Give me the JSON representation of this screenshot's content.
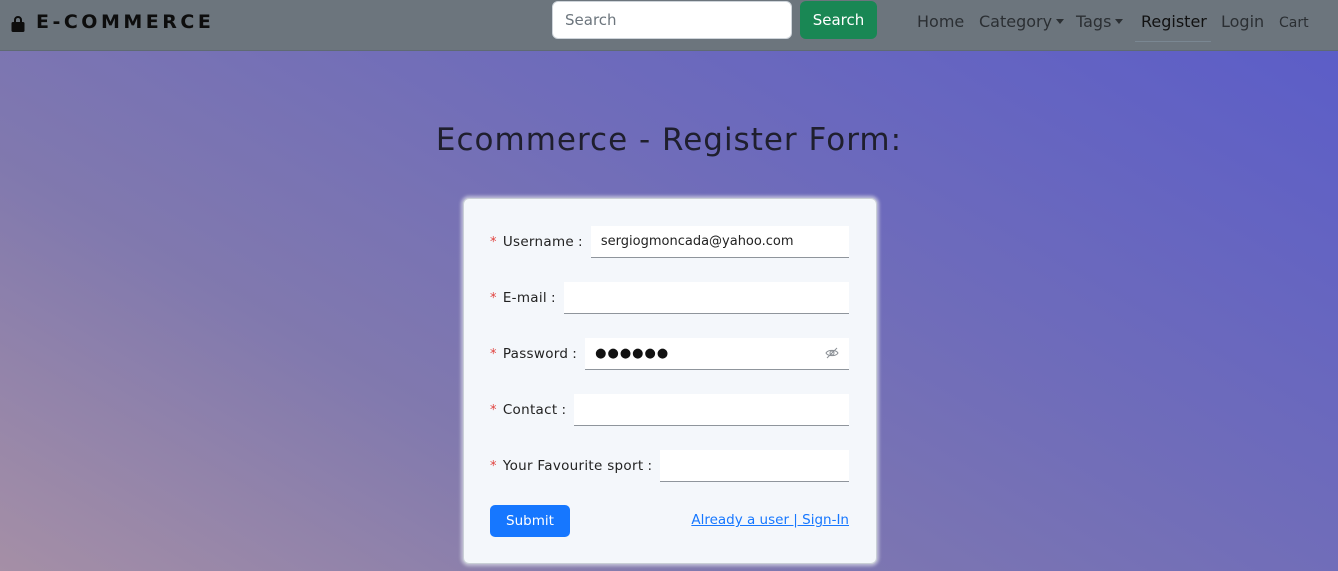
{
  "navbar": {
    "brand": "E-COMMERCE",
    "brand_icon": "shopping-bag-icon",
    "search_placeholder": "Search",
    "search_button": "Search",
    "links": {
      "home": "Home",
      "category": "Category",
      "tags": "Tags",
      "register": "Register",
      "login": "Login",
      "cart": "Cart"
    },
    "active_link": "Register"
  },
  "page": {
    "title": "Ecommerce - Register Form:"
  },
  "form": {
    "required_mark": "*",
    "fields": {
      "username": {
        "label": "Username",
        "value": "sergiogmoncada@yahoo.com"
      },
      "email": {
        "label": "E-mail",
        "value": ""
      },
      "password": {
        "label": "Password",
        "value": "●●●●●●",
        "toggle_icon": "eye-hidden-icon"
      },
      "contact": {
        "label": "Contact",
        "value": ""
      },
      "sport": {
        "label": "Your Favourite sport",
        "value": ""
      }
    },
    "submit_label": "Submit",
    "signin_link": "Already a user | Sign-In"
  },
  "colors": {
    "navbar_bg": "#6c757d",
    "search_button_bg": "#198754",
    "primary": "#1677ff",
    "required": "#e0413d"
  }
}
